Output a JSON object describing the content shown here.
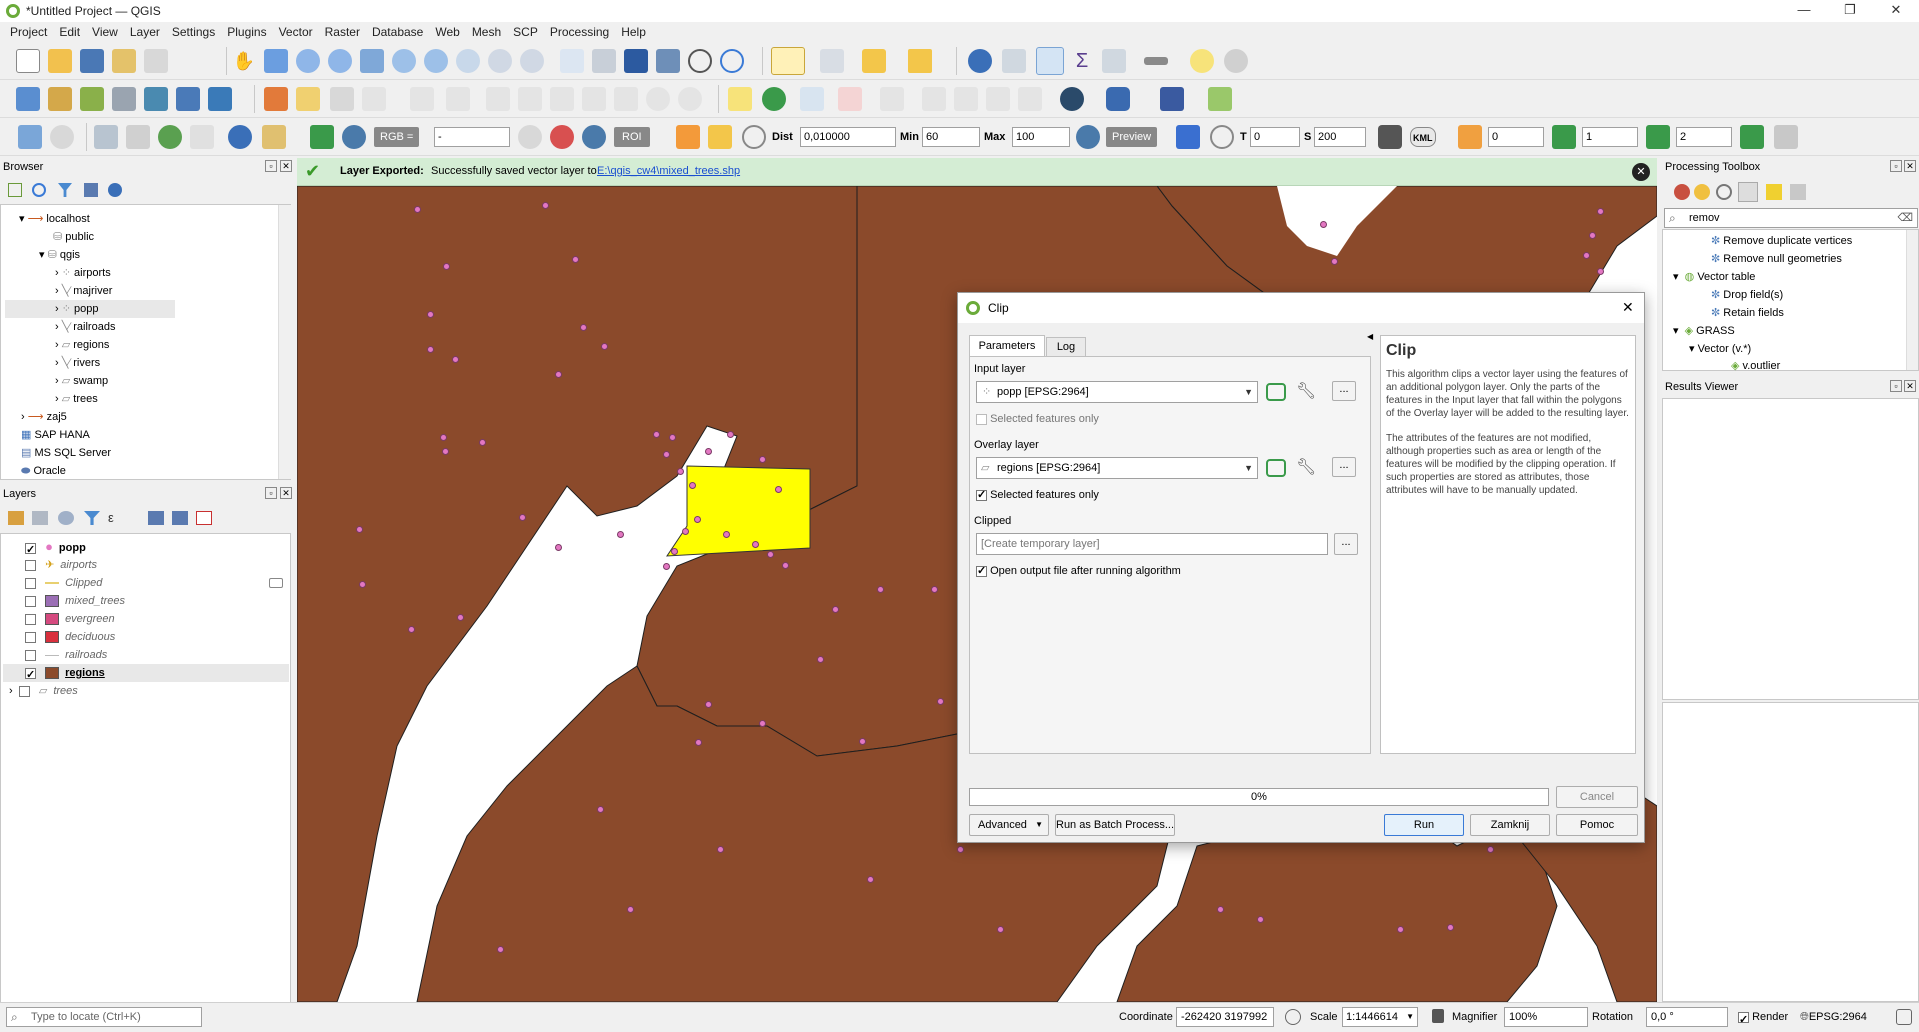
{
  "window": {
    "title": "*Untitled Project — QGIS"
  },
  "menu": [
    "Project",
    "Edit",
    "View",
    "Layer",
    "Settings",
    "Plugins",
    "Vector",
    "Raster",
    "Database",
    "Web",
    "Mesh",
    "SCP",
    "Processing",
    "Help"
  ],
  "toolbar3": {
    "rgb_label": "RGB =",
    "rgb_value": "-",
    "roi_label": "ROI",
    "dist_label": "Dist",
    "dist_value": "0,010000",
    "min_label": "Min",
    "min_value": "60",
    "max_label": "Max",
    "max_value": "100",
    "preview_label": "Preview",
    "t_label": "T",
    "t_value": "0",
    "s_label": "S",
    "s_value": "200",
    "kml_label": "KML",
    "band1_value": "0",
    "band2_value": "1",
    "band3_value": "2"
  },
  "browser": {
    "title": "Browser",
    "items": [
      {
        "label": "localhost"
      },
      {
        "label": "public"
      },
      {
        "label": "qgis"
      },
      {
        "label": "airports"
      },
      {
        "label": "majriver"
      },
      {
        "label": "popp"
      },
      {
        "label": "railroads"
      },
      {
        "label": "regions"
      },
      {
        "label": "rivers"
      },
      {
        "label": "swamp"
      },
      {
        "label": "trees"
      },
      {
        "label": "zaj5"
      },
      {
        "label": "SAP HANA"
      },
      {
        "label": "MS SQL Server"
      },
      {
        "label": "Oracle"
      }
    ]
  },
  "layers": {
    "title": "Layers",
    "items": [
      {
        "label": "popp",
        "checked": true,
        "color": "#e377c2"
      },
      {
        "label": "airports",
        "checked": false,
        "color": "#d4a017"
      },
      {
        "label": "Clipped",
        "checked": false,
        "color": "#e8d070"
      },
      {
        "label": "mixed_trees",
        "checked": false,
        "color": "#9b6fb5"
      },
      {
        "label": "evergreen",
        "checked": false,
        "color": "#d54a7f"
      },
      {
        "label": "deciduous",
        "checked": false,
        "color": "#d9303d"
      },
      {
        "label": "railroads",
        "checked": false,
        "color": "#bbbbbb"
      },
      {
        "label": "regions",
        "checked": true,
        "color": "#8b4a2b"
      },
      {
        "label": "trees",
        "checked": false,
        "color": "#ffffff"
      }
    ]
  },
  "message": {
    "bold": "Layer Exported:",
    "text": "Successfully saved vector layer to",
    "link": "E:\\qgis_cw4\\mixed_trees.shp"
  },
  "dialog": {
    "title": "Clip",
    "tabs": [
      "Parameters",
      "Log"
    ],
    "input_layer_label": "Input layer",
    "input_layer_value": "popp [EPSG:2964]",
    "selected_only_1": "Selected features only",
    "overlay_layer_label": "Overlay layer",
    "overlay_layer_value": "regions [EPSG:2964]",
    "selected_only_2": "Selected features only",
    "clipped_label": "Clipped",
    "clipped_placeholder": "[Create temporary layer]",
    "open_output": "Open output file after running algorithm",
    "help_title": "Clip",
    "help_p1": "This algorithm clips a vector layer using the features of an additional polygon layer. Only the parts of the features in the Input layer that fall within the polygons of the Overlay layer will be added to the resulting layer.",
    "help_p2": "The attributes of the features are not modified, although properties such as area or length of the features will be modified by the clipping operation. If such properties are stored as attributes, those attributes will have to be manually updated.",
    "progress": "0%",
    "cancel": "Cancel",
    "advanced": "Advanced",
    "batch": "Run as Batch Process...",
    "run": "Run",
    "close": "Zamknij",
    "help": "Pomoc"
  },
  "toolbox": {
    "title": "Processing Toolbox",
    "search": "remov",
    "items": [
      {
        "label": "Remove duplicate vertices"
      },
      {
        "label": "Remove null geometries"
      },
      {
        "label": "Vector table"
      },
      {
        "label": "Drop field(s)"
      },
      {
        "label": "Retain fields"
      },
      {
        "label": "GRASS"
      },
      {
        "label": "Vector (v.*)"
      },
      {
        "label": "v.outlier"
      }
    ]
  },
  "results": {
    "title": "Results Viewer"
  },
  "statusbar": {
    "locate_placeholder": "Type to locate (Ctrl+K)",
    "coordinate_label": "Coordinate",
    "coordinate_value": "-262420  3197992",
    "scale_label": "Scale",
    "scale_value": "1:1446614",
    "magnifier_label": "Magnifier",
    "magnifier_value": "100%",
    "rotation_label": "Rotation",
    "rotation_value": "0,0 °",
    "render_label": "Render",
    "crs": "EPSG:2964"
  }
}
